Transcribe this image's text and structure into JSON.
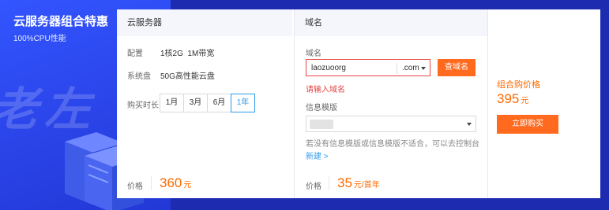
{
  "promo": {
    "title": "云服务器组合特惠",
    "subtitle": "100%CPU性能",
    "watermark": "老左"
  },
  "server_col": {
    "header": "云服务器",
    "config_label": "配置",
    "config_value": "1核2G  1M带宽",
    "disk_label": "系统盘",
    "disk_value": "50G高性能云盘",
    "duration_label": "购买时长",
    "durations": [
      "1月",
      "3月",
      "6月",
      "1年"
    ],
    "selected_duration": "1年",
    "price_label": "价格",
    "price_value": "360",
    "price_unit": "元"
  },
  "domain_col": {
    "header": "域名",
    "domain_label": "域名",
    "domain_value": "laozuoorg",
    "suffix_value": ".com",
    "query_button": "查域名",
    "error_text": "请输入域名",
    "template_label": "信息模版",
    "hint_text": "若没有信息模版或信息模版不适合，可以去控制台",
    "hint_link": "新建 >",
    "price_label": "价格",
    "price_value": "35",
    "price_unit": "元/首年"
  },
  "combo": {
    "label": "组合购价格",
    "price_value": "395",
    "price_unit": "元",
    "buy_button": "立即购买"
  },
  "colors": {
    "accent": "#ff6a00",
    "button": "#ff6a1f",
    "link": "#2f9ae9",
    "error": "#e54545",
    "promo_blue": "#2a44e8"
  }
}
